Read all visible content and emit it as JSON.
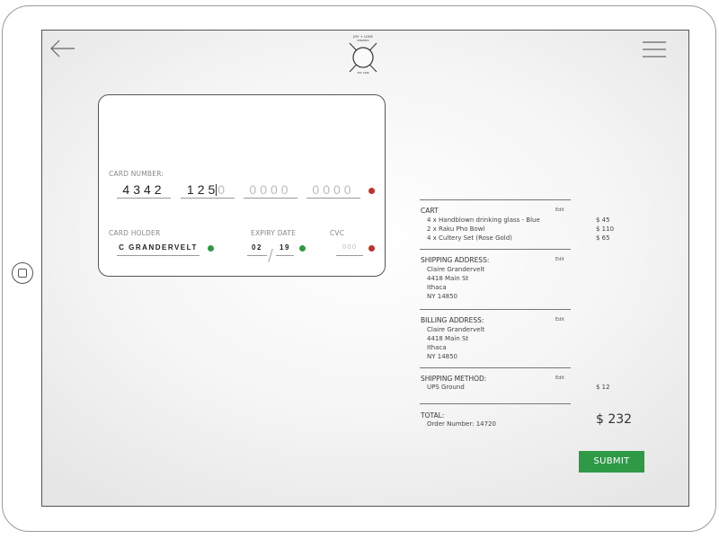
{
  "logo": {
    "top_text": "JOY + LOVE",
    "sub_text": "CERAMICS",
    "est": "EST. 1998"
  },
  "card": {
    "number_label": "CARD NUMBER:",
    "number_group1": "4342",
    "number_group2_typed": "125",
    "number_group2_placeholder": "0",
    "number_group3_placeholder": "0000",
    "number_group4_placeholder": "0000",
    "holder_label": "CARD HOLDER",
    "holder_value": "C GRANDERVELT",
    "expiry_label": "EXPIRY DATE",
    "expiry_month": "02",
    "expiry_year": "19",
    "expiry_separator": "/",
    "cvc_label": "CVC",
    "cvc_placeholder": "000"
  },
  "summary": {
    "edit_label": "Edit",
    "cart": {
      "title": "CART",
      "items": [
        {
          "label": "4 x Handblown drinking glass - Blue",
          "price": "$   45"
        },
        {
          "label": "2 x Raku Pho Bowl",
          "price": "$   110"
        },
        {
          "label": "4 x Cultery Set (Rose Gold)",
          "price": "$   65"
        }
      ]
    },
    "shipping_address": {
      "title": "SHIPPING ADDRESS:",
      "lines": [
        "Claire Grandervelt",
        "4418 Main St",
        "Ithaca",
        "NY 14850"
      ]
    },
    "billing_address": {
      "title": "BILLING ADDRESS:",
      "lines": [
        "Claire Grandervelt",
        "4418 Main St",
        "Ithaca",
        "NY 14850"
      ]
    },
    "shipping_method": {
      "title": "SHIPPING METHOD:",
      "method": "UPS Ground",
      "price": "$   12"
    },
    "total": {
      "title": "TOTAL:",
      "order_number": "Order Number: 14720",
      "amount": "$ 232"
    }
  },
  "submit_label": "SUBMIT",
  "colors": {
    "accent_green": "#2e9a46",
    "status_red": "#c0312b"
  },
  "icons": [
    "back-arrow-icon",
    "hamburger-menu-icon",
    "home-button-icon"
  ]
}
